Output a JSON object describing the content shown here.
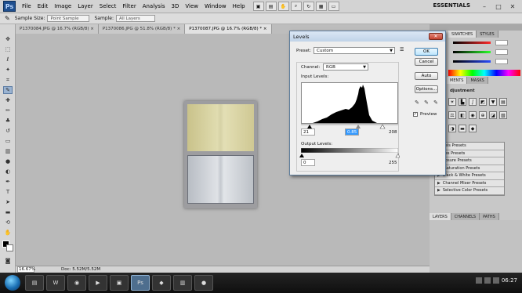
{
  "app": {
    "logo": "Ps",
    "menu": [
      "File",
      "Edit",
      "Image",
      "Layer",
      "Select",
      "Filter",
      "Analysis",
      "3D",
      "View",
      "Window",
      "Help"
    ],
    "workspace": "ESSENTIALS",
    "window_controls": [
      "–",
      "□",
      "✕"
    ]
  },
  "options_bar": {
    "sample_size_label": "Sample Size:",
    "sample_size_value": "Point Sample",
    "sample_label": "Sample:",
    "sample_value": "All Layers"
  },
  "tabs": [
    {
      "label": "P1370084.JPG @ 16.7% (RGB/8) ×"
    },
    {
      "label": "P1370086.JPG @ 51.8% (RGB/8) * ×"
    },
    {
      "label": "P1370087.JPG @ 16.7% (RGB/8) * ×"
    }
  ],
  "status": {
    "zoom": "16.67%",
    "doc": "Doc: 5.52M/5.52M"
  },
  "panels": {
    "tabs_top": [
      "SWATCHES",
      "STYLES"
    ],
    "tabs_adj": [
      "MENTS",
      "MASKS"
    ],
    "adjustments_title": "djustment",
    "presets": [
      "vels Presets",
      "ves Presets",
      "posure Presets",
      "/Saturation Presets",
      "Black & White Presets",
      "Channel Mixer Presets",
      "Selective Color Presets"
    ],
    "tabs_layers": [
      "LAYERS",
      "CHANNELS",
      "PATHS"
    ]
  },
  "dialog": {
    "title": "Levels",
    "close": "✕",
    "preset_label": "Preset:",
    "preset_value": "Custom",
    "channel_label": "Channel:",
    "channel_value": "RGB",
    "input_levels_label": "Input Levels:",
    "input_black": "21",
    "input_gamma": "0.85",
    "input_white": "208",
    "output_levels_label": "Output Levels:",
    "output_black": "0",
    "output_white": "255",
    "buttons": {
      "ok": "OK",
      "cancel": "Cancel",
      "auto": "Auto",
      "options": "Options..."
    },
    "preview_label": "Preview",
    "preview_checked": true
  },
  "taskbar": {
    "time": "06:27"
  }
}
